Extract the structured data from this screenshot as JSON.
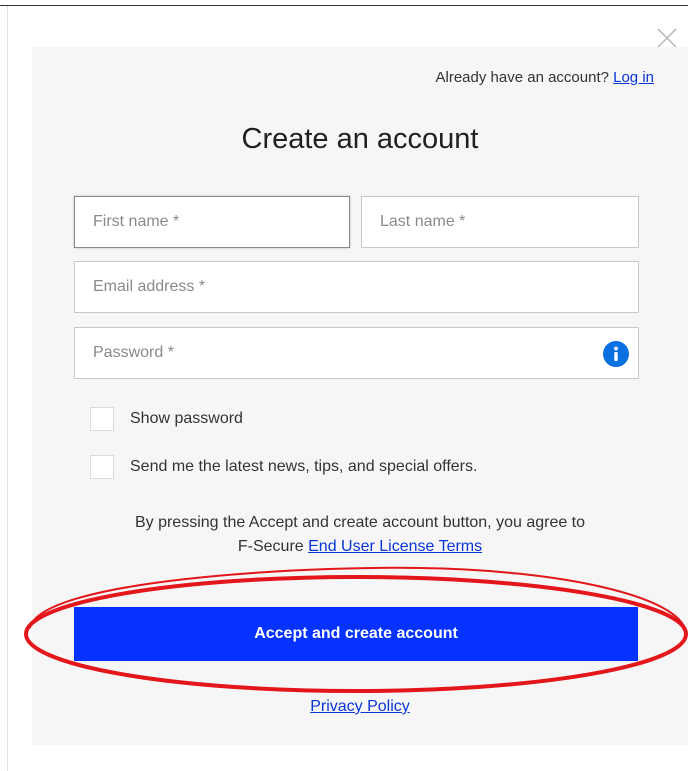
{
  "header": {
    "already_text": "Already have an account?",
    "login_link": "Log in",
    "close_icon": "close-icon"
  },
  "form": {
    "title": "Create an account",
    "first_name": {
      "placeholder": "First name *",
      "value": ""
    },
    "last_name": {
      "placeholder": "Last name *",
      "value": ""
    },
    "email": {
      "placeholder": "Email address *",
      "value": ""
    },
    "password": {
      "placeholder": "Password *",
      "value": "",
      "info_icon": "info-icon"
    },
    "show_password_label": "Show password",
    "newsletter_label": "Send me the latest news, tips, and special offers.",
    "agree_text": "By pressing the Accept and create account button, you agree to",
    "agree_text_2": "F-Secure",
    "eula_link": "End User License Terms",
    "accept_button": "Accept and create account",
    "privacy_link": "Privacy Policy"
  },
  "colors": {
    "accent": "#0532ff",
    "link": "#0a35d8",
    "info": "#0a6fe0",
    "annotation": "#e3161b",
    "panel": "#f6f6f6"
  }
}
